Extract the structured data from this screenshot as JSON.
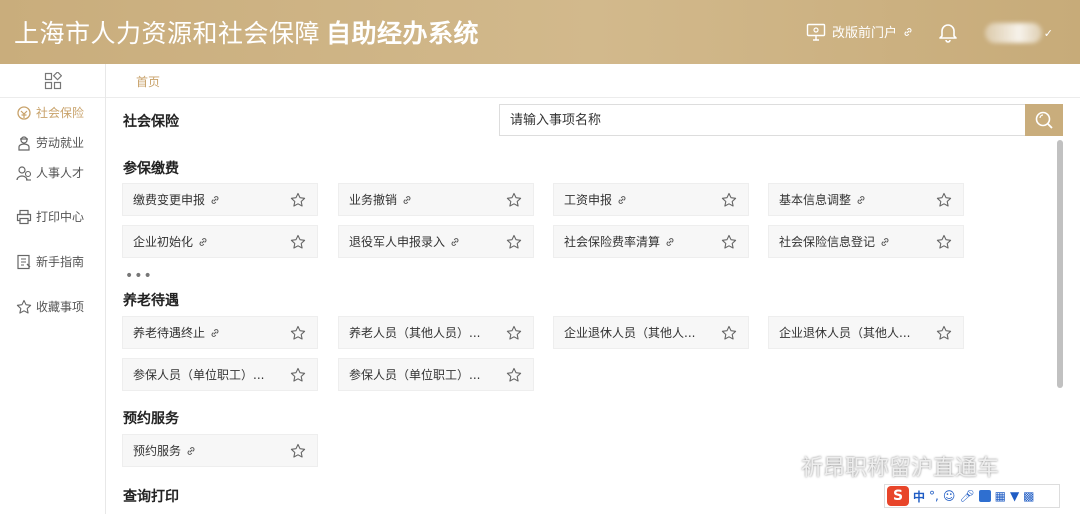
{
  "header": {
    "title_main": "上海市人力资源和社会保障",
    "title_sub": "自助经办系统",
    "portal_label": "改版前门户"
  },
  "sidebar": {
    "items": [
      {
        "label": "社会保险",
        "icon": "coins-icon",
        "active": true
      },
      {
        "label": "劳动就业",
        "icon": "worker-icon",
        "active": false
      },
      {
        "label": "人事人才",
        "icon": "users-icon",
        "active": false
      },
      {
        "label": "打印中心",
        "icon": "printer-icon",
        "active": false
      },
      {
        "label": "新手指南",
        "icon": "guide-icon",
        "active": false
      },
      {
        "label": "收藏事项",
        "icon": "star-icon",
        "active": false
      }
    ]
  },
  "breadcrumb": {
    "home": "首页"
  },
  "main": {
    "section_title": "社会保险",
    "search_placeholder": "请输入事项名称",
    "more_label": "•••",
    "categories": [
      {
        "title": "参保缴费",
        "items": [
          "缴费变更申报",
          "业务撤销",
          "工资申报",
          "基本信息调整",
          "企业初始化",
          "退役军人申报录入",
          "社会保险费率清算",
          "社会保险信息登记"
        ]
      },
      {
        "title": "养老待遇",
        "items": [
          "养老待遇终止",
          "养老人员（其他人员）...",
          "企业退休人员（其他人...",
          "企业退休人员（其他人...",
          "参保人员（单位职工）...",
          "参保人员（单位职工）..."
        ]
      },
      {
        "title": "预约服务",
        "items": [
          "预约服务"
        ]
      },
      {
        "title": "查询打印",
        "items": []
      }
    ]
  },
  "watermark": {
    "text": "祈昂职称留沪直通车"
  },
  "ime": {
    "logo": "S",
    "mode": "中"
  },
  "colors": {
    "header_gold": "#c9ad7c",
    "accent": "#c8a26a"
  }
}
